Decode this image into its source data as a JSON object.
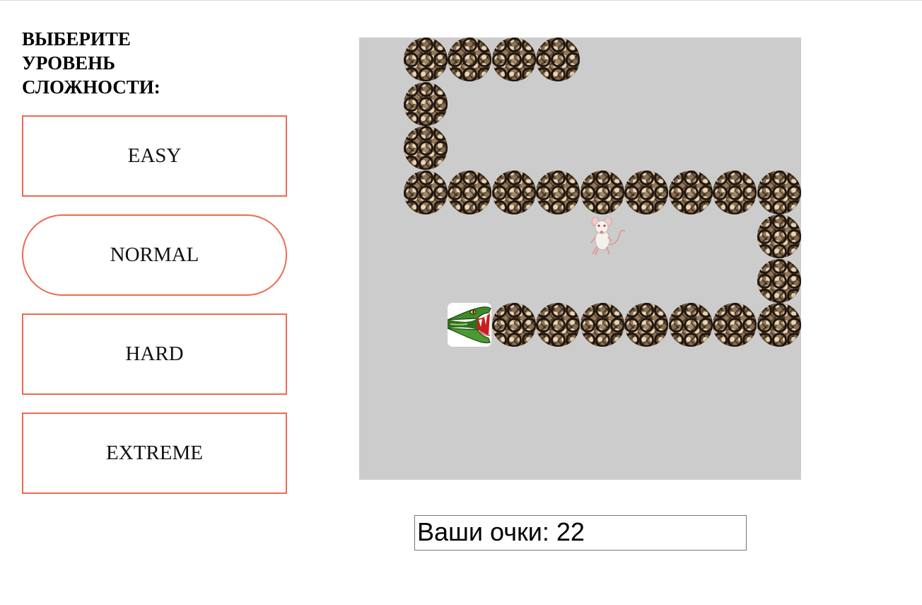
{
  "sidebar": {
    "title": "ВЫБЕРИТЕ УРОВЕНЬ СЛОЖНОСТИ:",
    "levels": [
      {
        "label": "EASY",
        "selected": false
      },
      {
        "label": "NORMAL",
        "selected": true
      },
      {
        "label": "HARD",
        "selected": false
      },
      {
        "label": "EXTREME",
        "selected": false
      }
    ],
    "accent_color": "#ee6a52"
  },
  "game": {
    "board_color": "#cccccc",
    "grid_cells": 10,
    "snake": {
      "head": {
        "col": 2,
        "row": 6,
        "facing": "left",
        "icon": "snake-head-icon"
      },
      "body": [
        [
          3,
          6
        ],
        [
          4,
          6
        ],
        [
          5,
          6
        ],
        [
          6,
          6
        ],
        [
          7,
          6
        ],
        [
          8,
          6
        ],
        [
          9,
          6
        ],
        [
          9,
          5
        ],
        [
          9,
          4
        ],
        [
          9,
          3
        ],
        [
          8,
          3
        ],
        [
          7,
          3
        ],
        [
          6,
          3
        ],
        [
          5,
          3
        ],
        [
          4,
          3
        ],
        [
          3,
          3
        ],
        [
          2,
          3
        ],
        [
          1,
          3
        ],
        [
          1,
          2
        ],
        [
          1,
          1
        ],
        [
          1,
          0
        ],
        [
          2,
          0
        ],
        [
          3,
          0
        ],
        [
          4,
          0
        ]
      ]
    },
    "mouse": {
      "col": 5,
      "row": 4,
      "icon": "mouse-icon"
    }
  },
  "score": {
    "text": "Ваши очки: 22",
    "value": 22
  }
}
